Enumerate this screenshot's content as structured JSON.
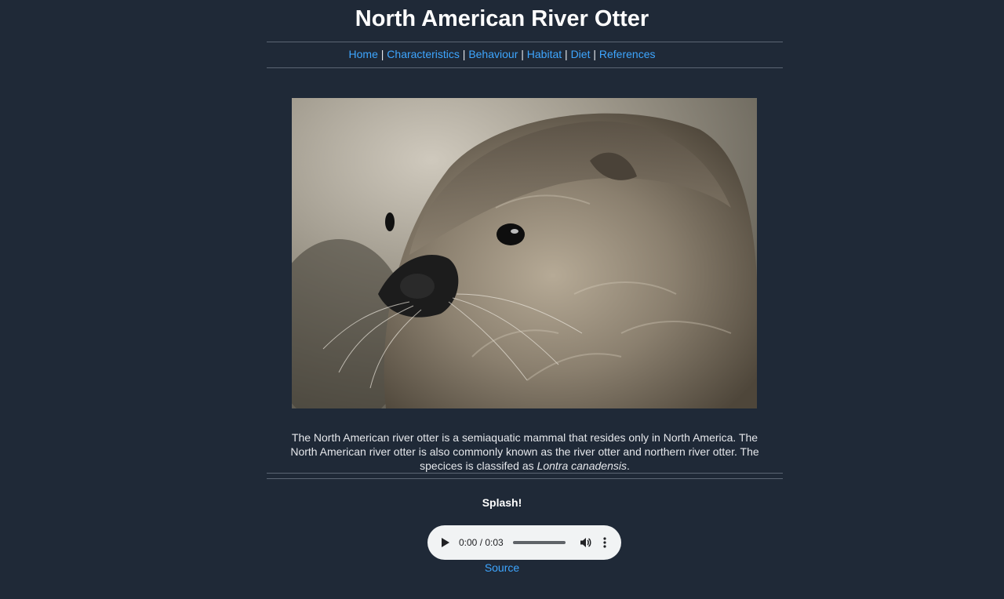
{
  "header": {
    "title": "North American River Otter"
  },
  "nav": {
    "items": [
      {
        "label": "Home"
      },
      {
        "label": "Characteristics"
      },
      {
        "label": "Behaviour"
      },
      {
        "label": "Habitat"
      },
      {
        "label": "Diet"
      },
      {
        "label": "References"
      }
    ],
    "separator": "|"
  },
  "photo": {
    "icon": "otter-photo"
  },
  "description": {
    "text": "The North American river otter is a semiaquatic mammal that resides only in North America. The North American river otter is also commonly known as the river otter and northern river otter. The specices is classifed as ",
    "species": "Lontra canadensis",
    "end": "."
  },
  "audio": {
    "title": "Splash!",
    "time": "0:00 / 0:03",
    "progress": 0,
    "source_label": "Source"
  },
  "colors": {
    "background": "#1f2937",
    "link": "#3ea6ff",
    "text": "#e5e7eb"
  }
}
